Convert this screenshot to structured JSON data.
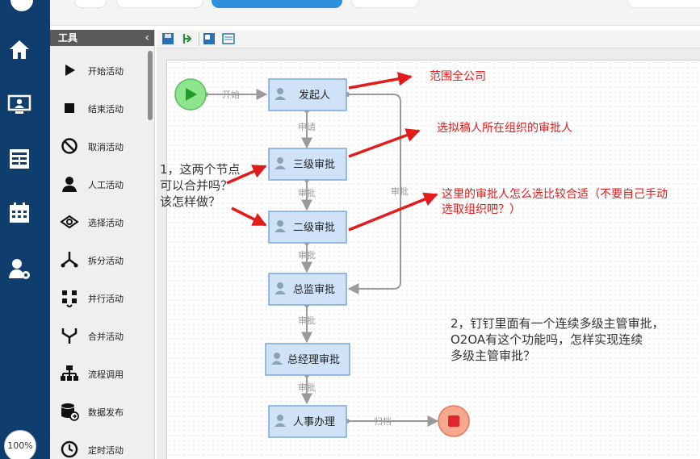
{
  "app": {
    "zoom_label": "100%",
    "nav_icons": [
      "home-icon",
      "desktop-user-icon",
      "form-icon",
      "calendar-icon",
      "user-settings-icon"
    ]
  },
  "tool_panel": {
    "title": "工具",
    "collapse_icon": "chevron-left-icon",
    "tools": [
      {
        "icon": "play-icon",
        "label": "开始活动"
      },
      {
        "icon": "stop-square-icon",
        "label": "结束活动"
      },
      {
        "icon": "cancel-circle-icon",
        "label": "取消活动"
      },
      {
        "icon": "person-icon",
        "label": "人工活动"
      },
      {
        "icon": "choice-eye-icon",
        "label": "选择活动"
      },
      {
        "icon": "split-icon",
        "label": "拆分活动"
      },
      {
        "icon": "parallel-icon",
        "label": "并行活动"
      },
      {
        "icon": "merge-icon",
        "label": "合并活动"
      },
      {
        "icon": "process-call-icon",
        "label": "流程调用"
      },
      {
        "icon": "database-publish-icon",
        "label": "数据发布"
      },
      {
        "icon": "timer-icon",
        "label": "定时活动"
      }
    ]
  },
  "canvas_toolbar": [
    "save-icon",
    "publish-icon",
    "save-as-icon",
    "properties-icon"
  ],
  "flow": {
    "start_edge_label": "开始",
    "end_edge_label": "归档",
    "nodes": [
      {
        "id": "n1",
        "label": "发起人"
      },
      {
        "id": "n2",
        "label": "三级审批"
      },
      {
        "id": "n3",
        "label": "二级审批"
      },
      {
        "id": "n4",
        "label": "总监审批"
      },
      {
        "id": "n5",
        "label": "总经理审批"
      },
      {
        "id": "n6",
        "label": "人事办理"
      }
    ],
    "edges": [
      {
        "label": "申请"
      },
      {
        "label": "审批"
      },
      {
        "label": "审批"
      },
      {
        "label": "审批"
      },
      {
        "label": "审批"
      },
      {
        "label": "审批"
      }
    ],
    "colors": {
      "node_fill": "#cfe2f7",
      "node_border": "#7aa7d6",
      "start_fill": "#8de68d",
      "end_fill": "#f7a98f",
      "annotation": "#e21b1b"
    }
  },
  "annotations": {
    "red": [
      "范围全公司",
      "选拟稿人所在组织的审批人",
      "这里的审批人怎么选比较合适（不要自己手动",
      "选取组织吧？）"
    ],
    "question1": [
      "1，这两个节点",
      "可以合并吗？",
      "该怎样做？"
    ],
    "question2": [
      "2，钉钉里面有一个连续多级主管审批，",
      "O2OA有这个功能吗，怎样实现连续",
      "多级主管审批？"
    ]
  }
}
